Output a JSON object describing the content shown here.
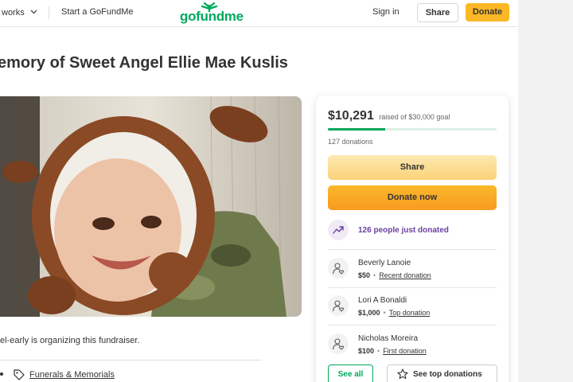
{
  "header": {
    "how_it_works": "works",
    "start": "Start a GoFundMe",
    "logo": "gofundme",
    "sign_in": "Sign in",
    "share": "Share",
    "donate": "Donate"
  },
  "campaign": {
    "title": "emory of Sweet Angel Ellie Mae Kuslis",
    "organizer_text": "el-early is organizing this fundraiser.",
    "category": "Funerals & Memorials"
  },
  "donation": {
    "raised": "$10,291",
    "goal_text": "raised of $30,000 goal",
    "progress_fraction": 0.34,
    "count": "127 donations",
    "share": "Share",
    "donate_now": "Donate now",
    "trend": "126 people just donated",
    "donors": [
      {
        "name": "Beverly Lanoie",
        "amount": "$50",
        "tag": "Recent donation"
      },
      {
        "name": "Lori A Bonaldi",
        "amount": "$1,000",
        "tag": "Top donation"
      },
      {
        "name": "Nicholas Moreira",
        "amount": "$100",
        "tag": "First donation"
      }
    ],
    "see_all": "See all",
    "see_top": "See top donations"
  },
  "colors": {
    "brand_green": "#02a95c",
    "donate_orange": "#fbb824",
    "trend_purple": "#6b3fa0"
  },
  "icons": [
    "chevron-down-icon",
    "sprout-logo-icon",
    "tag-icon",
    "trending-up-icon",
    "user-heart-icon",
    "star-icon"
  ]
}
